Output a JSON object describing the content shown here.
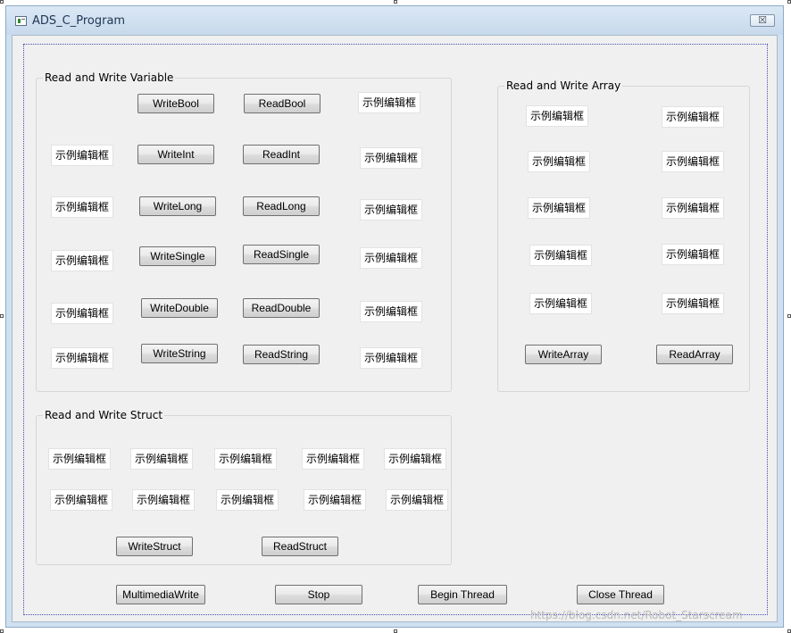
{
  "window": {
    "title": "ADS_C_Program",
    "close_glyph": "☒"
  },
  "variable_group": {
    "label": "Read and Write Variable",
    "write_buttons": [
      "WriteBool",
      "WriteInt",
      "WriteLong",
      "WriteSingle",
      "WriteDouble",
      "WriteString"
    ],
    "read_buttons": [
      "ReadBool",
      "ReadInt",
      "ReadLong",
      "ReadSingle",
      "ReadDouble",
      "ReadString"
    ],
    "write_values": [
      "示例编辑框",
      "示例编辑框",
      "示例编辑框",
      "示例编辑框",
      "示例编辑框"
    ],
    "read_values": [
      "示例编辑框",
      "示例编辑框",
      "示例编辑框",
      "示例编辑框",
      "示例编辑框",
      "示例编辑框"
    ]
  },
  "array_group": {
    "label": "Read and Write Array",
    "left_values": [
      "示例编辑框",
      "示例编辑框",
      "示例编辑框",
      "示例编辑框",
      "示例编辑框"
    ],
    "right_values": [
      "示例编辑框",
      "示例编辑框",
      "示例编辑框",
      "示例编辑框",
      "示例编辑框"
    ],
    "write_button": "WriteArray",
    "read_button": "ReadArray"
  },
  "struct_group": {
    "label": "Read and Write Struct",
    "row1_values": [
      "示例编辑框",
      "示例编辑框",
      "示例编辑框",
      "示例编辑框",
      "示例编辑框"
    ],
    "row2_values": [
      "示例编辑框",
      "示例编辑框",
      "示例编辑框",
      "示例编辑框",
      "示例编辑框"
    ],
    "write_button": "WriteStruct",
    "read_button": "ReadStruct"
  },
  "bottom_buttons": {
    "multimedia_write": "MultimediaWrite",
    "stop": "Stop",
    "begin_thread": "Begin Thread",
    "close_thread": "Close Thread"
  },
  "watermark": "https://blog.csdn.net/Robot_Starscream"
}
